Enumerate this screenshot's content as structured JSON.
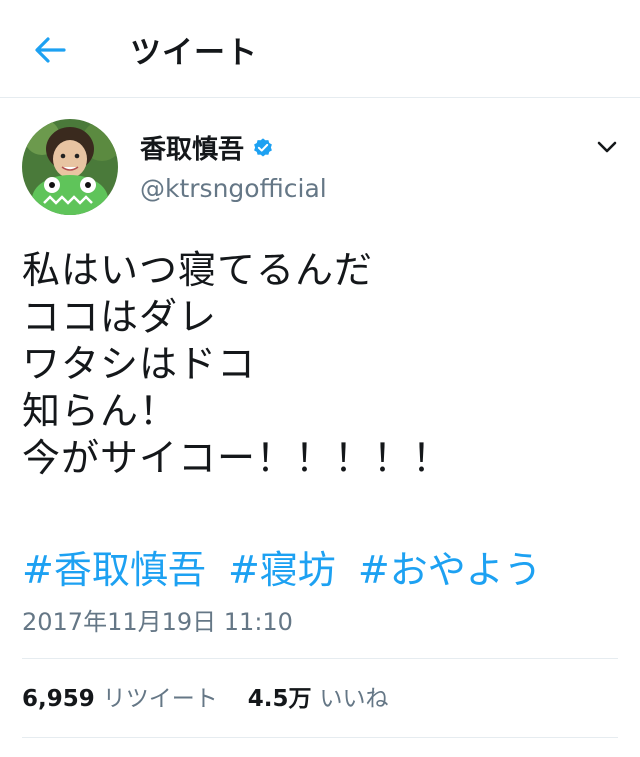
{
  "header": {
    "title": "ツイート",
    "back_icon": "arrow-left-icon",
    "accent_color": "#1da1f2"
  },
  "tweet": {
    "user": {
      "name": "香取慎吾",
      "handle": "@ktrsngofficial",
      "verified_icon": "verified-badge-icon"
    },
    "menu_icon": "chevron-down-icon",
    "text_lines": [
      "私はいつ寝てるんだ",
      "ココはダレ",
      "ワタシはドコ",
      "知らん！",
      "今がサイコー！！！！！"
    ],
    "hashtags": [
      "#香取慎吾",
      "#寝坊",
      "#おやよう"
    ],
    "timestamp": "2017年11月19日 11:10",
    "stats": {
      "retweets_count": "6,959",
      "retweets_label": "リツイート",
      "likes_count": "4.5万",
      "likes_label": "いいね"
    }
  }
}
